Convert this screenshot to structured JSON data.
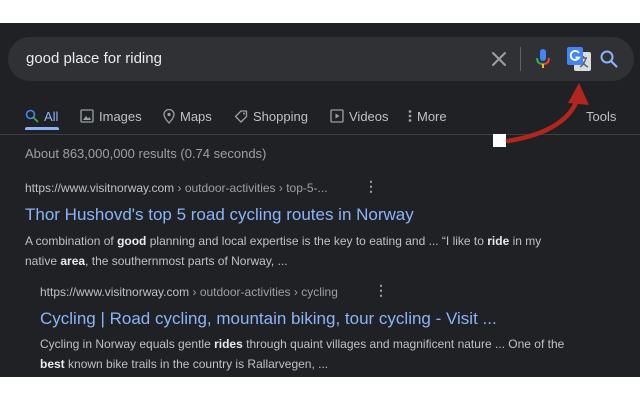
{
  "search": {
    "query": "good place for riding"
  },
  "tabs": [
    {
      "label": "All"
    },
    {
      "label": "Images"
    },
    {
      "label": "Maps"
    },
    {
      "label": "Shopping"
    },
    {
      "label": "Videos"
    },
    {
      "label": "More"
    }
  ],
  "tools_label": "Tools",
  "stats": "About 863,000,000 results (0.74 seconds)",
  "results": [
    {
      "domain": "https://www.visitnorway.com",
      "path": " › outdoor-activities › top-5-...",
      "title": "Thor Hushovd's top 5 road cycling routes in Norway",
      "snippet": [
        {
          "t": "A combination of ",
          "b": false
        },
        {
          "t": "good",
          "b": true
        },
        {
          "t": " planning and local expertise is the key to eating and ... “I like to ",
          "b": false
        },
        {
          "t": "ride",
          "b": true
        },
        {
          "t": " in my native ",
          "b": false
        },
        {
          "t": "area",
          "b": true
        },
        {
          "t": ", the southernmost parts of Norway, ...",
          "b": false
        }
      ]
    },
    {
      "domain": "https://www.visitnorway.com",
      "path": " › outdoor-activities › cycling",
      "title": "Cycling | Road cycling, mountain biking, tour cycling - Visit ...",
      "snippet": [
        {
          "t": "Cycling in Norway equals gentle ",
          "b": false
        },
        {
          "t": "rides",
          "b": true
        },
        {
          "t": " through quaint villages and magnificent nature ... One of the ",
          "b": false
        },
        {
          "t": "best",
          "b": true
        },
        {
          "t": " known bike trails in the country is Rallarvegen, ...",
          "b": false
        }
      ]
    }
  ],
  "colors": {
    "background": "#202124",
    "searchbar": "#303134",
    "link": "#8ab4f8",
    "text": "#bdc1c6",
    "annotation_arrow": "#b3261e"
  },
  "icons": [
    "search-icon",
    "clear-icon",
    "mic-icon",
    "google-translate-icon",
    "images-icon",
    "maps-icon",
    "shopping-icon",
    "videos-icon",
    "more-icon",
    "kebab-menu-icon"
  ]
}
